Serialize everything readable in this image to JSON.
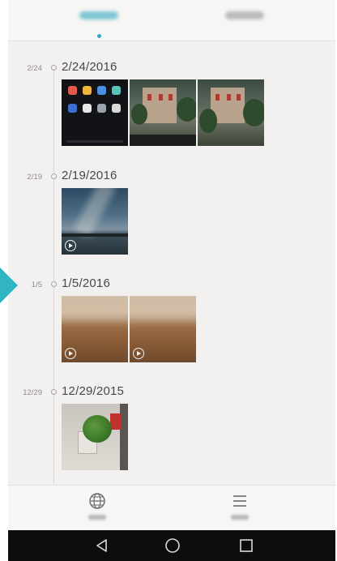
{
  "header": {
    "tabs": [
      {
        "label": "",
        "active": true
      },
      {
        "label": "",
        "active": false
      }
    ]
  },
  "timeline": {
    "sections": [
      {
        "short_date": "2/24",
        "date": "2/24/2016"
      },
      {
        "short_date": "2/19",
        "date": "2/19/2016"
      },
      {
        "short_date": "1/5",
        "date": "1/5/2016"
      },
      {
        "short_date": "12/29",
        "date": "12/29/2015"
      }
    ]
  },
  "bottom_nav": {
    "items": [
      {
        "icon": "globe-icon",
        "label": ""
      },
      {
        "icon": "menu-icon",
        "label": ""
      }
    ]
  },
  "system_nav": {
    "buttons": [
      "back-icon",
      "home-icon",
      "recent-apps-icon"
    ]
  },
  "colors": {
    "accent": "#33a7bc",
    "pointer": "#2fb6c2",
    "background": "#f3f1f0"
  }
}
